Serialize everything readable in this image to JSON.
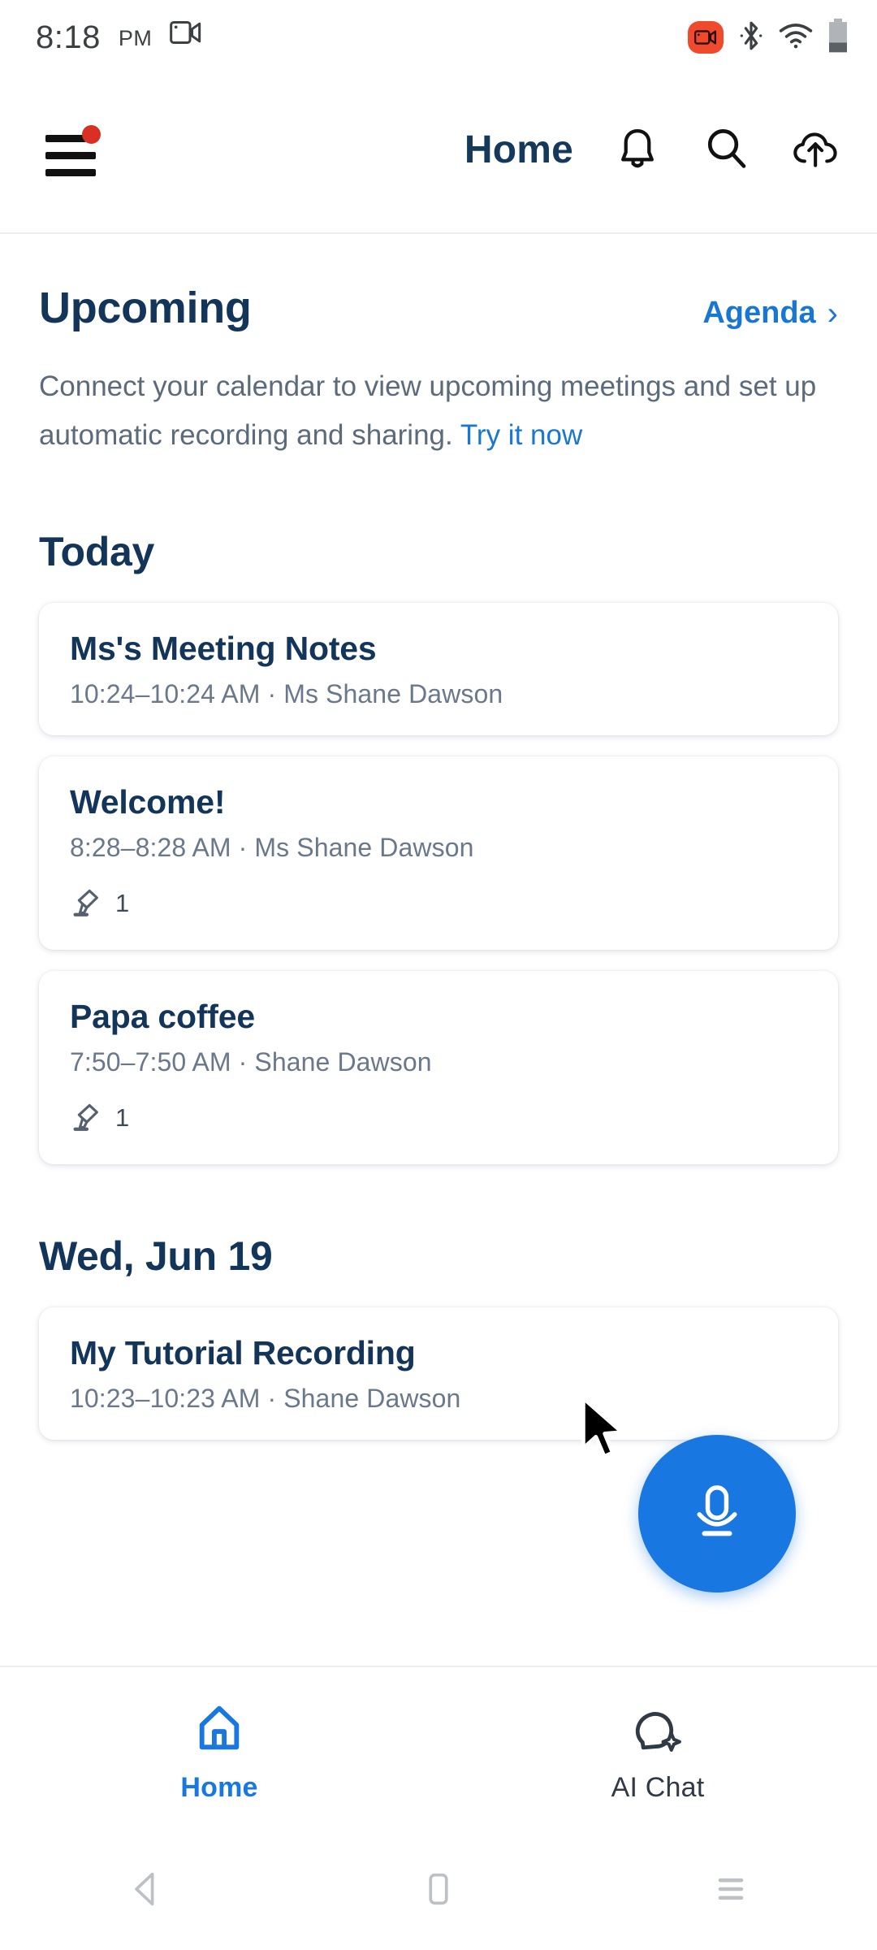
{
  "status_bar": {
    "time": "8:18",
    "ampm": "PM",
    "left_icon": "screen-record-icon",
    "right_icons": [
      "recording-badge-icon",
      "bluetooth-icon",
      "wifi-icon",
      "battery-icon"
    ]
  },
  "header": {
    "menu_icon": "hamburger-menu-icon",
    "menu_badge": true,
    "title": "Home",
    "icons": [
      "bell-icon",
      "search-icon",
      "cloud-upload-icon"
    ]
  },
  "upcoming": {
    "title": "Upcoming",
    "link_label": "Agenda",
    "link_chevron": "›",
    "blurb_before": "Connect your calendar to view upcoming meetings and set up automatic recording and sharing. ",
    "blurb_link": "Try it now"
  },
  "sections": [
    {
      "day_label": "Today",
      "cards": [
        {
          "title": "Ms's Meeting Notes",
          "meta": "10:24–10:24 AM ·  Ms Shane Dawson",
          "has_stats": false,
          "stat_icon": "highlighter-icon",
          "stat_count": ""
        },
        {
          "title": "Welcome!",
          "meta": "8:28–8:28 AM ·  Ms Shane Dawson",
          "has_stats": true,
          "stat_icon": "highlighter-icon",
          "stat_count": "1"
        },
        {
          "title": "Papa coffee",
          "meta": "7:50–7:50 AM ·  Shane Dawson",
          "has_stats": true,
          "stat_icon": "highlighter-icon",
          "stat_count": "1"
        }
      ]
    },
    {
      "day_label": "Wed, Jun 19",
      "cards": [
        {
          "title": "My Tutorial Recording",
          "meta": "10:23–10:23 AM ·  Shane Dawson",
          "has_stats": false,
          "stat_icon": "highlighter-icon",
          "stat_count": ""
        }
      ]
    }
  ],
  "fab": {
    "icon": "microphone-icon"
  },
  "bottom_nav": {
    "items": [
      {
        "label": "Home",
        "icon": "home-icon",
        "active": true
      },
      {
        "label": "AI Chat",
        "icon": "ai-chat-icon",
        "active": false
      }
    ]
  },
  "android_nav": {
    "back": "back-triangle-icon",
    "home": "home-square-icon",
    "recents": "recents-lines-icon"
  },
  "colors": {
    "accent_blue": "#1877e0",
    "link_blue": "#1877d2",
    "navy": "#14355a",
    "muted_gray": "#69788a",
    "badge_red": "#d93025",
    "record_red": "#f04a2c"
  }
}
